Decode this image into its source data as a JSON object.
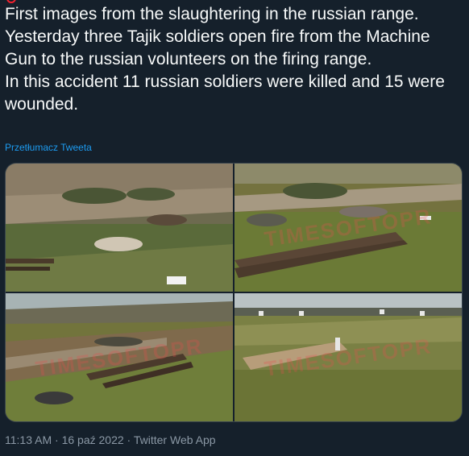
{
  "tweet": {
    "text": "First images from the slaughtering in the russian range.\nYesterday three Tajik soldiers open fire from the Machine Gun to the russian volunteers on the firing range.\nIn this accident 11 russian soldiers were killed and 15 were wounded.",
    "translate_label": "Przetłumacz Tweeta"
  },
  "media": {
    "watermark": "TIMESOFTOPR"
  },
  "meta": {
    "time": "11:13 AM",
    "separator": " · ",
    "date": "16 paź 2022",
    "app": "Twitter Web App"
  },
  "colors": {
    "background": "#15202b",
    "text": "#f7f9f9",
    "link": "#1d9bf0",
    "muted": "#8b98a5",
    "border": "#38444d"
  }
}
